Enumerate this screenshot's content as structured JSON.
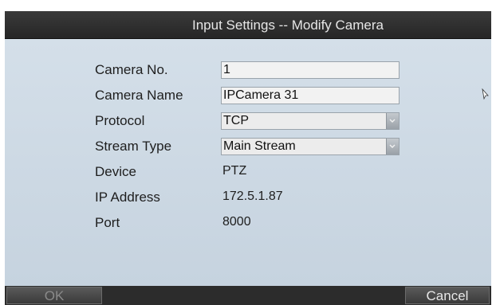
{
  "dialog": {
    "title": "Input Settings -- Modify Camera"
  },
  "fields": {
    "camera_no": {
      "label": "Camera No.",
      "value": "1"
    },
    "camera_name": {
      "label": "Camera Name",
      "value": "IPCamera 31"
    },
    "protocol": {
      "label": "Protocol",
      "value": "TCP"
    },
    "stream_type": {
      "label": "Stream Type",
      "value": "Main Stream"
    },
    "device": {
      "label": "Device",
      "value": "PTZ"
    },
    "ip_address": {
      "label": "IP Address",
      "value": "172.5.1.87"
    },
    "port": {
      "label": "Port",
      "value": "8000"
    }
  },
  "buttons": {
    "ok": "OK",
    "cancel": "Cancel"
  },
  "icons": {
    "dropdown": "chevron-down-icon",
    "cursor": "mouse-cursor-icon"
  }
}
